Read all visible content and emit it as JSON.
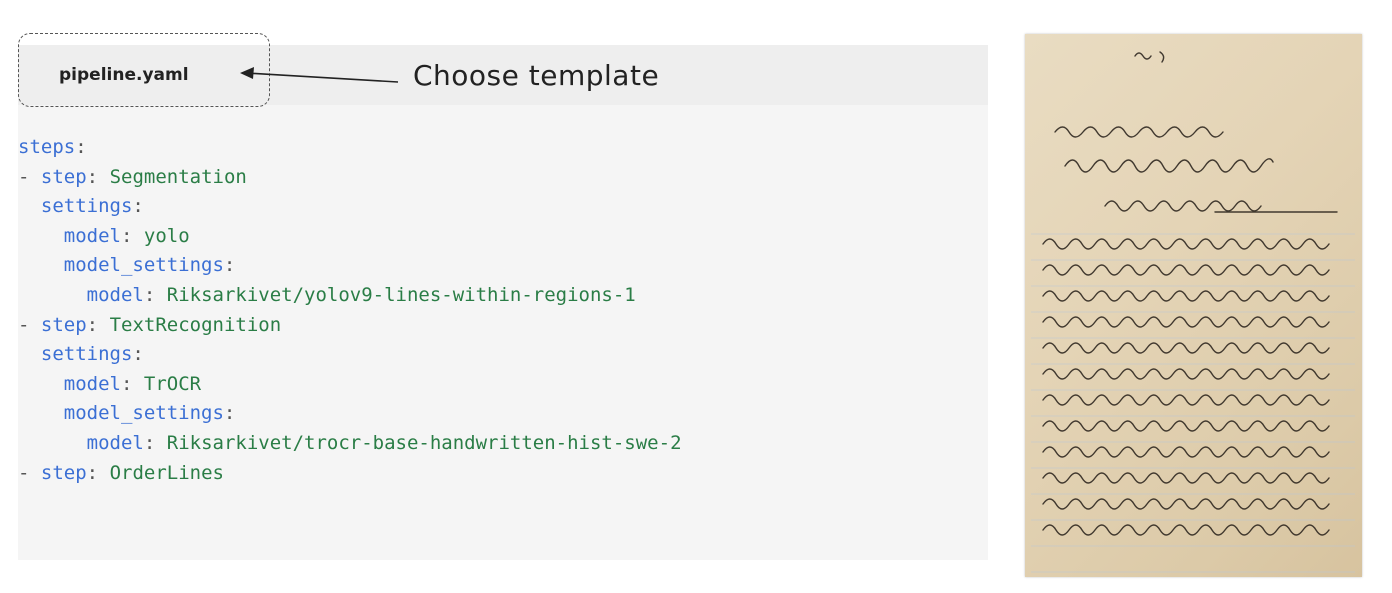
{
  "editor": {
    "filename": "pipeline.yaml",
    "annotation": "Choose template",
    "lines": [
      {
        "indent": "",
        "dash": "",
        "key": "steps",
        "value": ""
      },
      {
        "indent": "",
        "dash": "- ",
        "key": "step",
        "value": "Segmentation"
      },
      {
        "indent": "  ",
        "dash": "",
        "key": "settings",
        "value": ""
      },
      {
        "indent": "    ",
        "dash": "",
        "key": "model",
        "value": "yolo"
      },
      {
        "indent": "    ",
        "dash": "",
        "key": "model_settings",
        "value": ""
      },
      {
        "indent": "      ",
        "dash": "",
        "key": "model",
        "value": "Riksarkivet/yolov9-lines-within-regions-1"
      },
      {
        "indent": "",
        "dash": "- ",
        "key": "step",
        "value": "TextRecognition"
      },
      {
        "indent": "  ",
        "dash": "",
        "key": "settings",
        "value": ""
      },
      {
        "indent": "    ",
        "dash": "",
        "key": "model",
        "value": "TrOCR"
      },
      {
        "indent": "    ",
        "dash": "",
        "key": "model_settings",
        "value": ""
      },
      {
        "indent": "      ",
        "dash": "",
        "key": "model",
        "value": "Riksarkivet/trocr-base-handwritten-hist-swe-2"
      },
      {
        "indent": "",
        "dash": "- ",
        "key": "step",
        "value": "OrderLines"
      }
    ],
    "colors": {
      "key": "#3b6fd4",
      "value": "#2a7d46",
      "punctuation": "#555555",
      "background": "#f5f5f5",
      "filename_bar": "#eeeeee"
    }
  },
  "letter": {
    "icon": "handwritten-letter-image"
  }
}
